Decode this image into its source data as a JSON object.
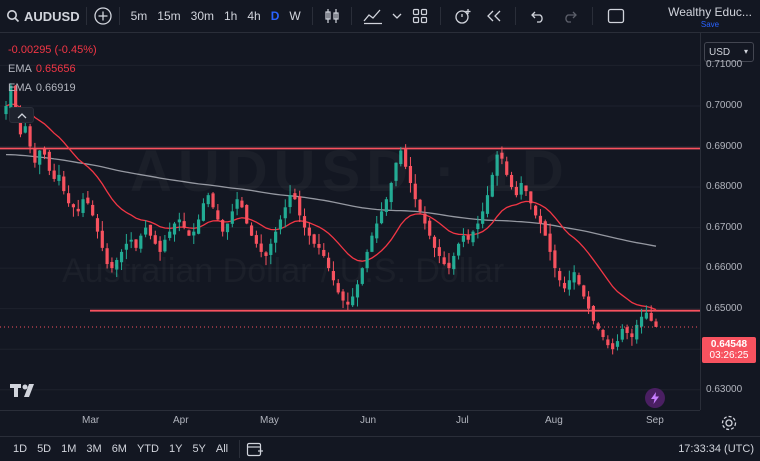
{
  "toolbar": {
    "symbol": "AUDUSD",
    "timeframes": [
      "5m",
      "15m",
      "30m",
      "1h",
      "4h",
      "D",
      "W"
    ],
    "active_timeframe": "D",
    "account_name": "Wealthy Educ...",
    "save_label": "Save"
  },
  "legend": {
    "change": "-0.00295 (-0.45%)",
    "ema1_label": "EMA",
    "ema1_value": "0.65656",
    "ema2_label": "EMA",
    "ema2_value": "0.66919"
  },
  "watermark": {
    "symbol_text": "AUDUSD · 1D",
    "name_text": "Australian Dollar / U.S. Dollar"
  },
  "price_axis": {
    "currency": "USD",
    "labels": [
      "0.71000",
      "0.70000",
      "0.69000",
      "0.68000",
      "0.67000",
      "0.66000",
      "0.65000",
      "0.64000",
      "0.63000"
    ],
    "current_price": "0.64548",
    "countdown": "03:26:25"
  },
  "time_axis": {
    "labels": [
      "Mar",
      "Apr",
      "May",
      "Jun",
      "Jul",
      "Aug",
      "Sep"
    ]
  },
  "bottom": {
    "ranges": [
      "1D",
      "5D",
      "1M",
      "3M",
      "6M",
      "YTD",
      "1Y",
      "5Y",
      "All"
    ],
    "clock": "17:33:34 (UTC)"
  },
  "colors": {
    "up": "#22ab94",
    "down": "#f7525f",
    "accent": "#2962ff",
    "ema_fast": "#f23645",
    "ema_slow": "#9598a1"
  },
  "chart_data": {
    "type": "candlestick",
    "ylim": [
      0.625,
      0.718
    ],
    "horizontal_lines": [
      0.6895,
      0.6495
    ],
    "note_series": "daily closes approx",
    "closes": [
      0.7,
      0.705,
      0.699,
      0.693,
      0.695,
      0.69,
      0.686,
      0.689,
      0.688,
      0.684,
      0.682,
      0.683,
      0.679,
      0.676,
      0.675,
      0.674,
      0.677,
      0.676,
      0.673,
      0.669,
      0.665,
      0.661,
      0.66,
      0.662,
      0.664,
      0.666,
      0.667,
      0.665,
      0.668,
      0.67,
      0.668,
      0.666,
      0.664,
      0.667,
      0.669,
      0.671,
      0.672,
      0.67,
      0.668,
      0.669,
      0.672,
      0.676,
      0.678,
      0.675,
      0.672,
      0.669,
      0.671,
      0.674,
      0.677,
      0.675,
      0.671,
      0.668,
      0.666,
      0.664,
      0.663,
      0.666,
      0.669,
      0.672,
      0.675,
      0.678,
      0.677,
      0.673,
      0.67,
      0.668,
      0.666,
      0.665,
      0.663,
      0.66,
      0.657,
      0.654,
      0.652,
      0.651,
      0.653,
      0.656,
      0.66,
      0.664,
      0.668,
      0.671,
      0.674,
      0.677,
      0.681,
      0.686,
      0.689,
      0.685,
      0.681,
      0.677,
      0.674,
      0.671,
      0.668,
      0.665,
      0.663,
      0.661,
      0.66,
      0.663,
      0.666,
      0.668,
      0.667,
      0.669,
      0.671,
      0.674,
      0.678,
      0.683,
      0.688,
      0.687,
      0.683,
      0.68,
      0.678,
      0.681,
      0.679,
      0.676,
      0.673,
      0.671,
      0.668,
      0.664,
      0.66,
      0.657,
      0.655,
      0.657,
      0.659,
      0.656,
      0.653,
      0.65,
      0.647,
      0.645,
      0.643,
      0.641,
      0.64,
      0.642,
      0.645,
      0.644,
      0.643,
      0.646,
      0.648,
      0.649,
      0.647,
      0.6455
    ]
  }
}
